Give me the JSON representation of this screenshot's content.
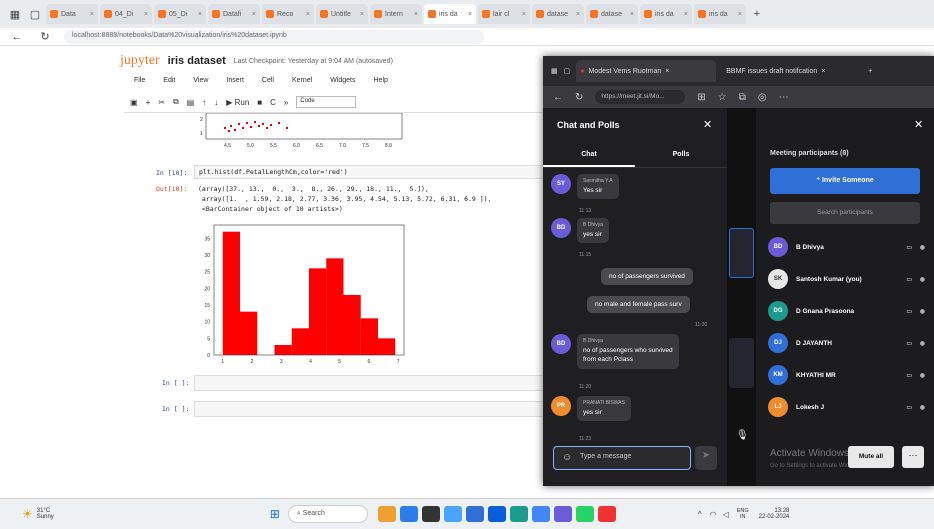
{
  "back_browser": {
    "tabs": [
      "Data",
      "04_Di",
      "05_Di",
      "Datafi",
      "Reco",
      "Untitle",
      "Intern",
      "iris da",
      "lair cl",
      "datase",
      "datase",
      "iris da",
      "iris da"
    ],
    "url": "localhost:8888/notebooks/Data%20visualization/iris%20dataset.ipynb"
  },
  "jupyter": {
    "logo": "jupyter",
    "notebook_title": "iris dataset",
    "checkpoint": "Last Checkpoint: Yesterday at 9:04 AM  (autosaved)",
    "menu": [
      "File",
      "Edit",
      "View",
      "Insert",
      "Cell",
      "Kernel",
      "Widgets",
      "Help"
    ],
    "run_label": "Run",
    "cell_type": "Code",
    "prev_xticks": [
      "4.5",
      "5.0",
      "5.5",
      "6.0",
      "6.5",
      "7.0",
      "7.5",
      "8.0"
    ],
    "prev_yticks": [
      "2",
      "1"
    ],
    "in10": "In [10]:",
    "code10": "plt.hist(df.PetalLengthCm,color='red')",
    "out10": "Out[10]:",
    "output_lines": [
      "(array([37., 13.,  0.,  3.,  8., 26., 29., 18., 11.,  5.]),",
      " array([1.  , 1.59, 2.18, 2.77, 3.36, 3.95, 4.54, 5.13, 5.72, 6.31, 6.9 ]),",
      " <BarContainer object of 10 artists>)"
    ],
    "in_empty_1": "In [ ]:",
    "in_empty_2": "In [ ]:"
  },
  "chart_data": {
    "type": "bar",
    "title": "",
    "color": "#ff0000",
    "bin_edges": [
      1.0,
      1.59,
      2.18,
      2.77,
      3.36,
      3.95,
      4.54,
      5.13,
      5.72,
      6.31,
      6.9
    ],
    "values": [
      37,
      13,
      0,
      3,
      8,
      26,
      29,
      18,
      11,
      5
    ],
    "xticks": [
      "1",
      "2",
      "3",
      "4",
      "5",
      "6",
      "7"
    ],
    "yticks": [
      "0",
      "5",
      "10",
      "15",
      "20",
      "25",
      "30",
      "35"
    ],
    "xlim": [
      0.7,
      7.2
    ],
    "ylim": [
      0,
      39
    ]
  },
  "front_browser": {
    "tab1": "Modest Vems Ruotman",
    "tab2": "BBMF issues draft notifcation",
    "url": "https://meet.jit.si/Mo..."
  },
  "chat": {
    "title": "Chat and Polls",
    "tab_chat": "Chat",
    "tab_polls": "Polls",
    "messages": [
      {
        "initials": "SY",
        "color": "#6b5bd6",
        "name": "Sasmitha Y.A",
        "text": "Yes sir",
        "time": "11:13"
      },
      {
        "initials": "BD",
        "color": "#6b5bd6",
        "name": "B Dhivya",
        "text": "yes sir",
        "time": "11:15"
      },
      {
        "initials": "BD",
        "color": "#6b5bd6",
        "name": "B Dhivya",
        "text1": "no of passengers who survived",
        "text2": "from each Pclass",
        "time": "11:20"
      },
      {
        "initials": "PR",
        "color": "#f08c2e",
        "name": "PRANATI BISWAS",
        "text": "yes sir",
        "time": "11:23"
      }
    ],
    "own_msg_1": "no of passengers survived",
    "own_msg_2": "no male and female pass surv",
    "own_time": "11:20",
    "input_placeholder": "Type a message"
  },
  "participants": {
    "title": "Meeting participants (8)",
    "invite": "Invite Someone",
    "search_placeholder": "Search participants",
    "list": [
      {
        "initials": "BD",
        "color": "#6b5bd6",
        "name": "B Dhivya"
      },
      {
        "initials": "SK",
        "color": "#e6e6e6",
        "name": "Santosh Kumar (you)"
      },
      {
        "initials": "DG",
        "color": "#1a9b8e",
        "name": "D Gnana Prasoona"
      },
      {
        "initials": "DJ",
        "color": "#2f6fd6",
        "name": "D JAYANTH"
      },
      {
        "initials": "KM",
        "color": "#2f6fd6",
        "name": "KHYATHI MR"
      },
      {
        "initials": "LJ",
        "color": "#f08c2e",
        "name": "Lokesh J"
      }
    ],
    "mute_all": "Mute all",
    "activate_title": "Activate Windows",
    "activate_sub": "Go to Settings to activate Windows."
  },
  "taskbar": {
    "weather_temp": "31°C",
    "weather_text": "Sunny",
    "search": "Search",
    "lang": "ENG",
    "region": "IN",
    "time": "13:28",
    "date": "22-02-2024"
  }
}
